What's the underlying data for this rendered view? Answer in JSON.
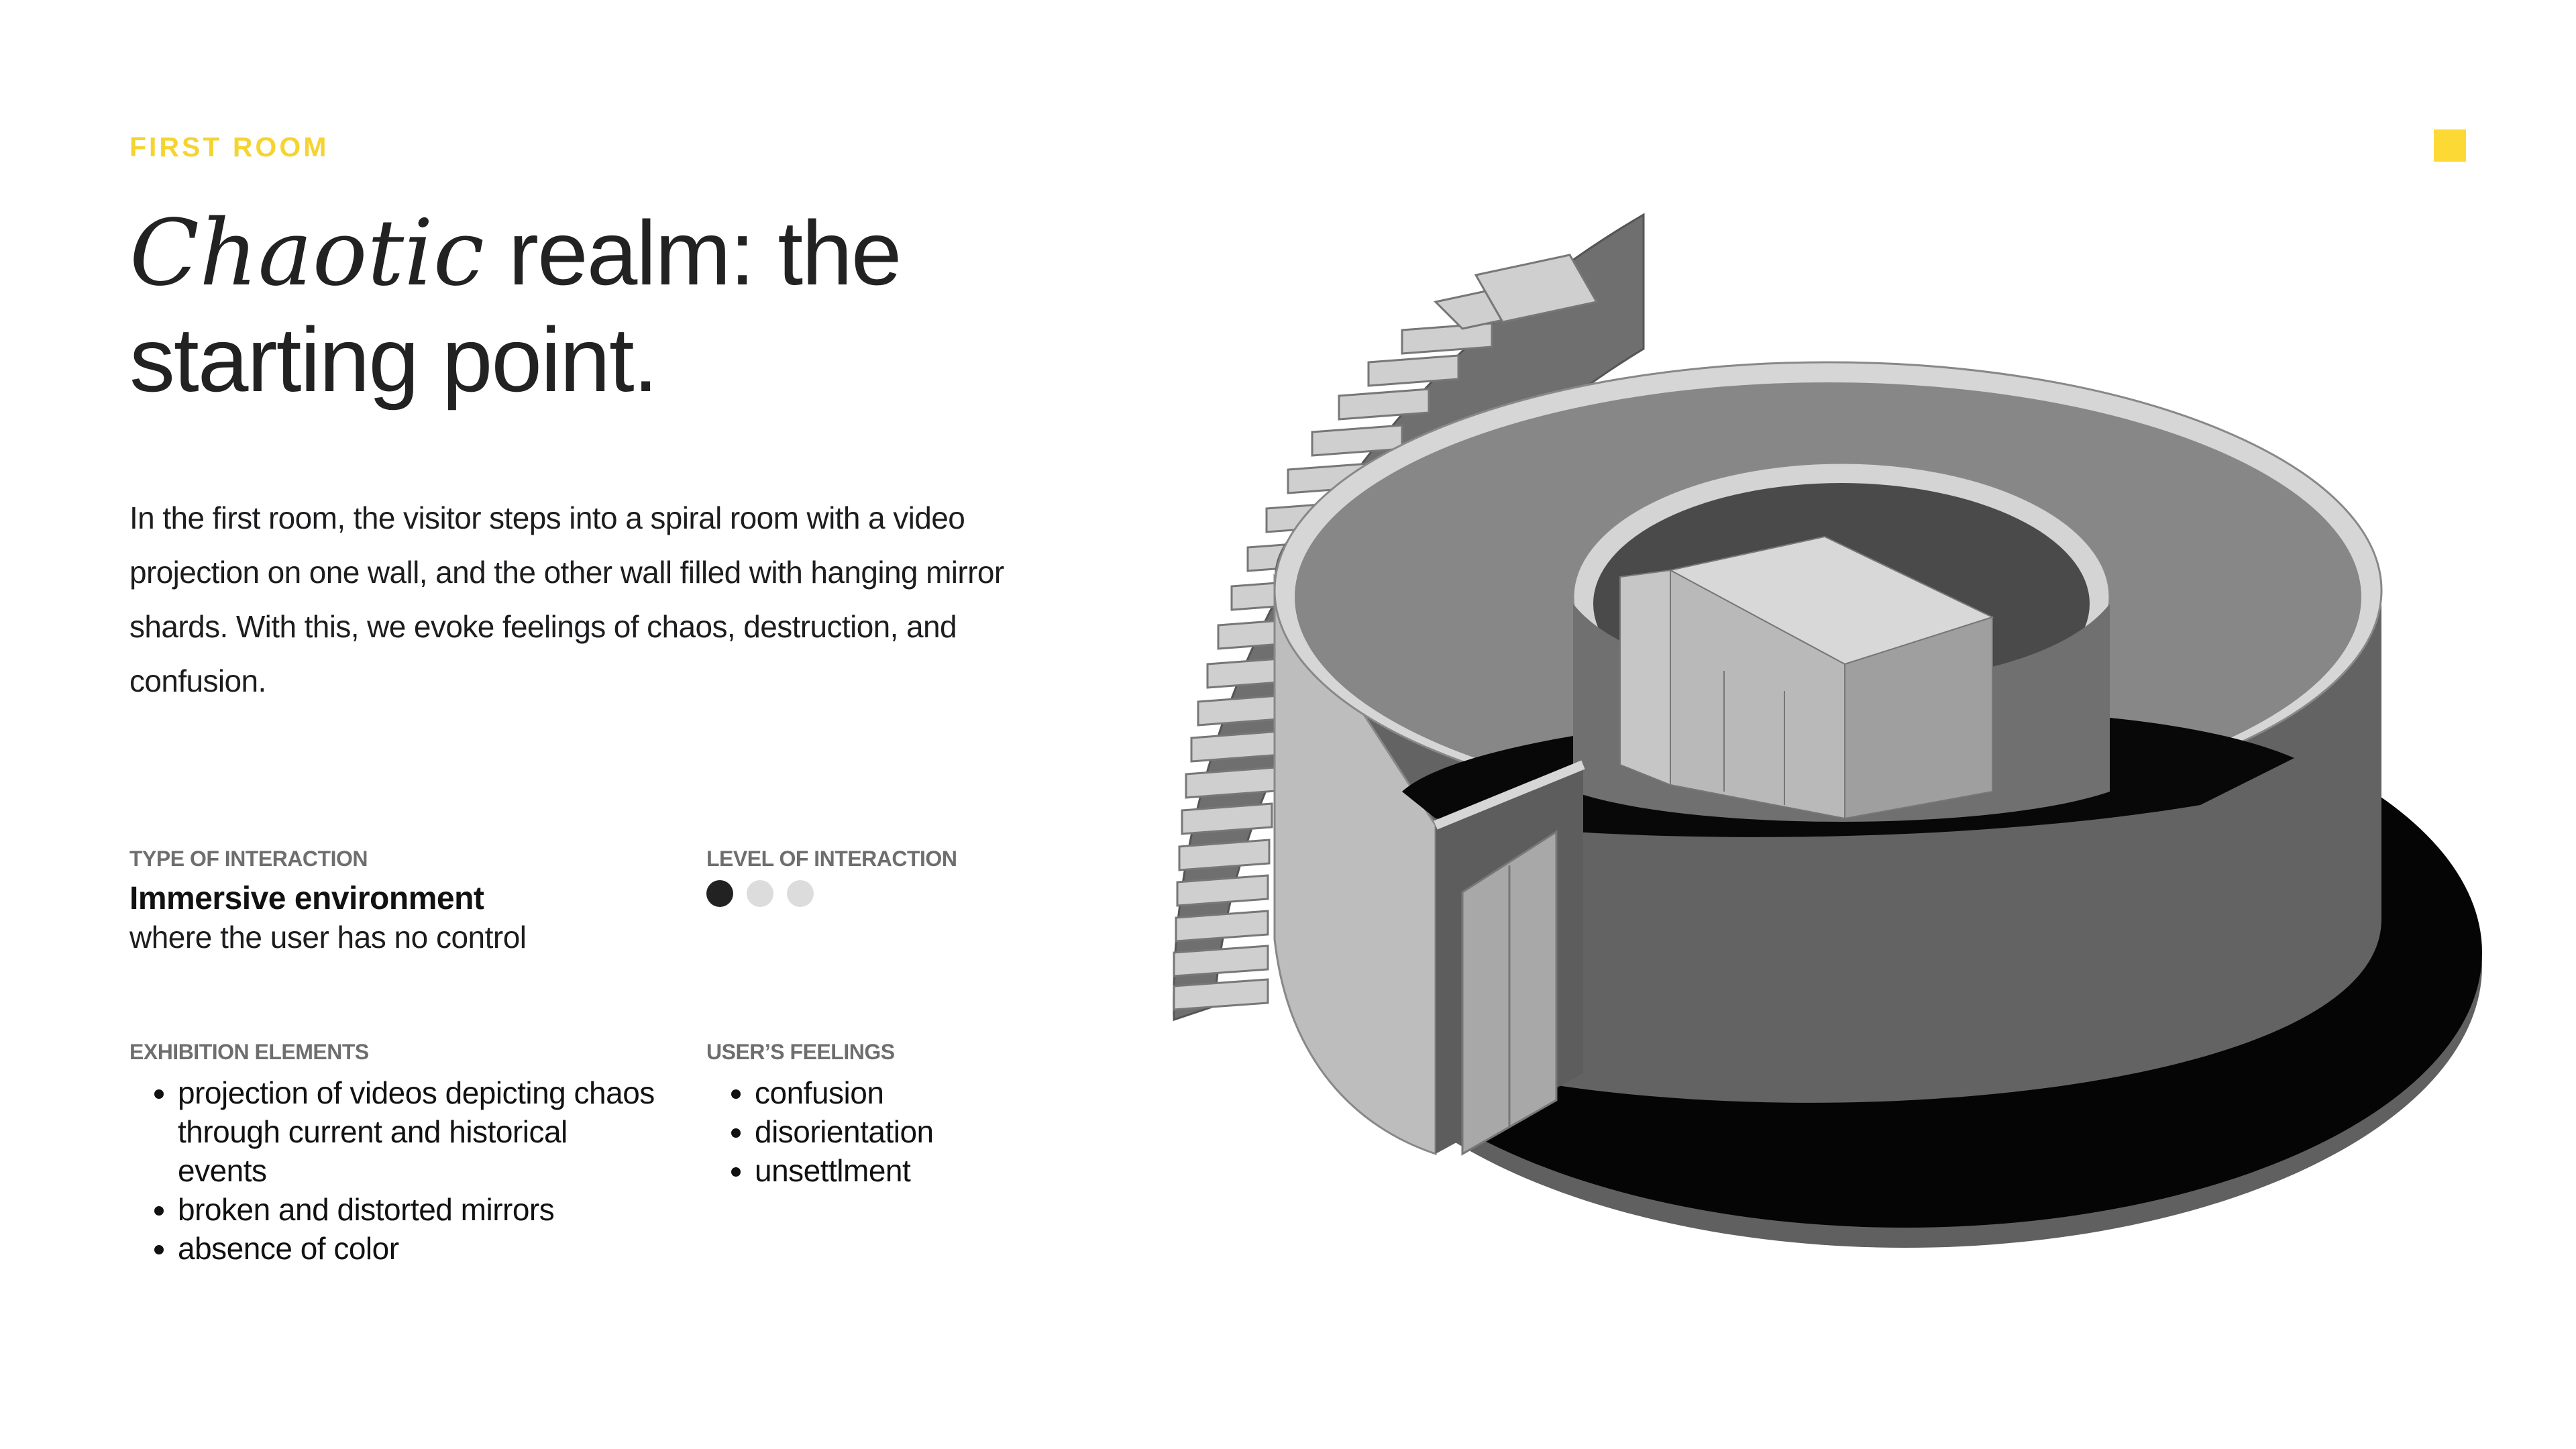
{
  "eyebrow": "FIRST ROOM",
  "headline": {
    "italic": "Chaotic",
    "rest_line1": " realm: the",
    "line2": "starting point."
  },
  "body": "In the first room, the visitor steps into a spiral room with a video projection on one wall, and the other wall filled with hanging mirror shards. With this, we evoke feelings of chaos, destruction, and confusion.",
  "type_of_interaction": {
    "label": "TYPE OF INTERACTION",
    "title": "Immersive environment",
    "subtitle": "where the user has no control"
  },
  "level_of_interaction": {
    "label": "LEVEL OF INTERACTION",
    "level": 1,
    "max": 3
  },
  "exhibition_elements": {
    "label": "EXHIBITION ELEMENTS",
    "items": [
      "projection of videos depicting chaos through current and historical events",
      "broken and distorted mirrors",
      "absence of color"
    ]
  },
  "users_feelings": {
    "label": "USER’S FEELINGS",
    "items": [
      "confusion",
      "disorientation",
      "unsettlment"
    ]
  },
  "colors": {
    "accent": "#fdd935",
    "eyebrow": "#f5d431",
    "text": "#1d1d1f",
    "muted": "#6e6e6e"
  },
  "illustration": {
    "subject": "isometric spiral room model"
  }
}
